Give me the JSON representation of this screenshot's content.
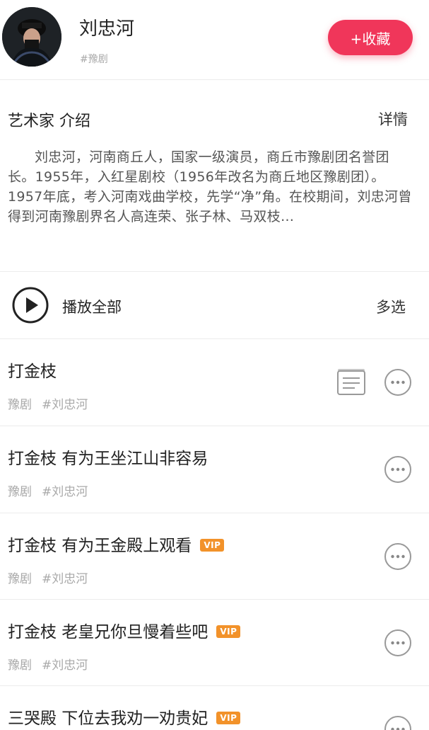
{
  "artist": {
    "name": "刘忠河",
    "tag": "#豫剧",
    "follow_label": "+收藏"
  },
  "intro": {
    "title": "艺术家 介绍",
    "details_label": "详情",
    "text": "刘忠河，河南商丘人，国家一级演员，商丘市豫剧团名誉团长。1955年，入红星剧校（1956年改名为商丘地区豫剧团）。1957年底，考入河南戏曲学校，先学“净”角。在校期间，刘忠河曾得到河南豫剧界名人高连荣、张子林、马双枝…"
  },
  "playlist": {
    "play_all_label": "播放全部",
    "multi_select_label": "多选"
  },
  "songs": [
    {
      "title": "打金枝",
      "vip": "",
      "genre": "豫剧",
      "artist_tag": "#刘忠河"
    },
    {
      "title": "打金枝 有为王坐江山非容易",
      "vip": "",
      "genre": "豫剧",
      "artist_tag": "#刘忠河"
    },
    {
      "title": "打金枝 有为王金殿上观看",
      "vip": "VIP",
      "genre": "豫剧",
      "artist_tag": "#刘忠河"
    },
    {
      "title": "打金枝 老皇兄你旦慢着些吧",
      "vip": "VIP",
      "genre": "豫剧",
      "artist_tag": "#刘忠河"
    },
    {
      "title": "三哭殿 下位去我劝一劝贵妃",
      "vip": "VIP",
      "genre": "",
      "artist_tag": ""
    }
  ],
  "colors": {
    "accent": "#f0365a",
    "vip": "#f2922a"
  }
}
